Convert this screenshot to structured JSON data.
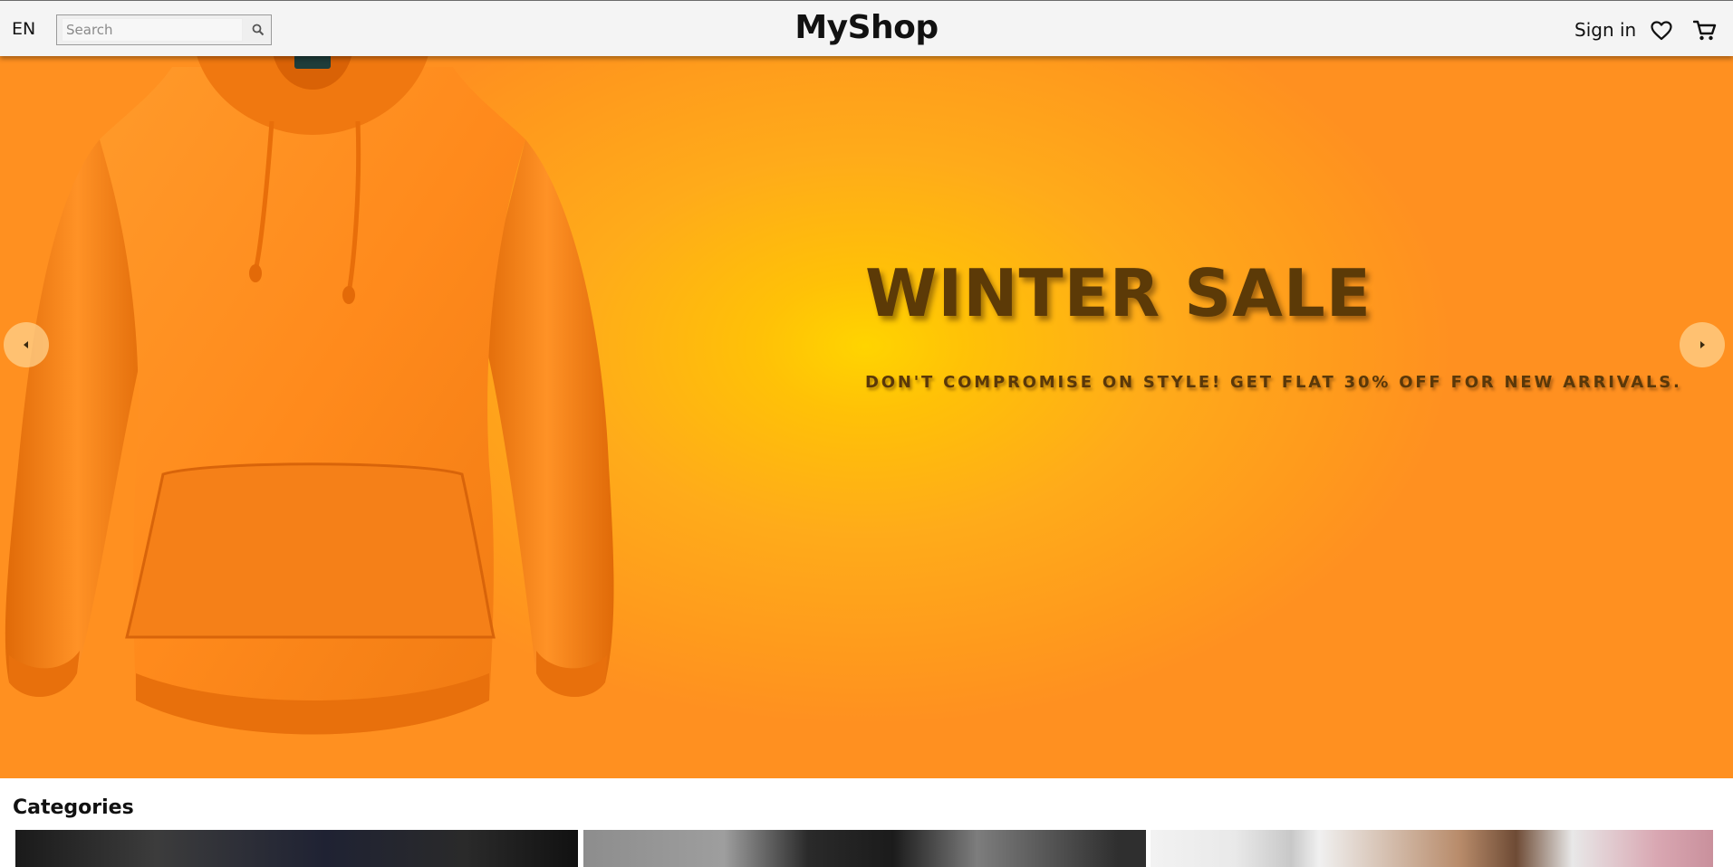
{
  "header": {
    "language": "EN",
    "search": {
      "placeholder": "Search",
      "value": ""
    },
    "logo": "MyShop",
    "sign_in_label": "Sign in"
  },
  "hero": {
    "title": "WINTER SALE",
    "subtitle": "DON'T COMPROMISE ON STYLE! GET FLAT 30% OFF FOR NEW ARRIVALS.",
    "background_color": "#ffb300",
    "title_color": "#5c3a07",
    "product_color": "#ff8a1c"
  },
  "categories": {
    "title": "Categories",
    "cards": [
      {
        "name": "category-card-1"
      },
      {
        "name": "category-card-2"
      },
      {
        "name": "category-card-3"
      }
    ]
  },
  "icons": {
    "search": "search-icon",
    "wishlist": "heart-icon",
    "cart": "cart-icon",
    "prev": "chevron-left-icon",
    "next": "chevron-right-icon"
  }
}
